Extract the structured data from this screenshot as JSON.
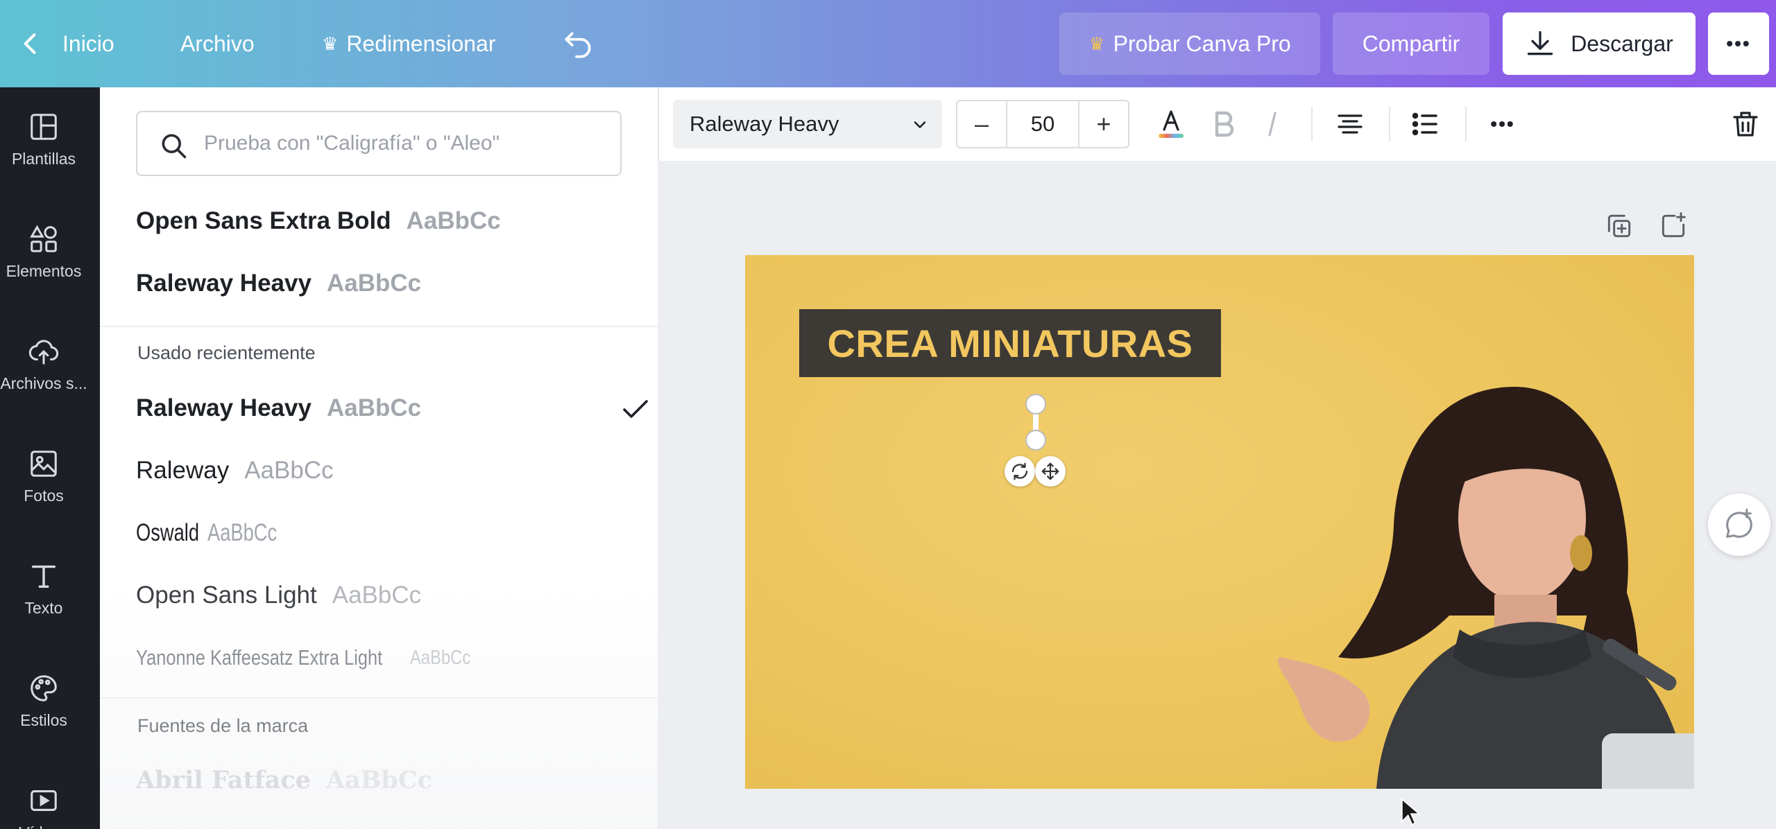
{
  "topbar": {
    "home_label": "Inicio",
    "file_label": "Archivo",
    "resize_label": "Redimensionar",
    "pro_label": "Probar Canva Pro",
    "share_label": "Compartir",
    "download_label": "Descargar",
    "more_label": "•••"
  },
  "rail": {
    "items": [
      {
        "label": "Plantillas",
        "icon": "layout-icon"
      },
      {
        "label": "Elementos",
        "icon": "shapes-icon"
      },
      {
        "label": "Archivos s...",
        "icon": "upload-cloud-icon"
      },
      {
        "label": "Fotos",
        "icon": "image-icon"
      },
      {
        "label": "Texto",
        "icon": "text-icon"
      },
      {
        "label": "Estilos",
        "icon": "palette-icon"
      },
      {
        "label": "Vídeos",
        "icon": "video-icon"
      }
    ]
  },
  "panel": {
    "search_placeholder": "Prueba con \"Caligrafía\" o \"Aleo\"",
    "sample_text": "AaBbCc",
    "top_fonts": [
      {
        "name": "Open Sans Extra Bold"
      },
      {
        "name": "Raleway Heavy"
      }
    ],
    "recent_title": "Usado recientemente",
    "recent_fonts": [
      {
        "name": "Raleway Heavy",
        "selected": true
      },
      {
        "name": "Raleway"
      },
      {
        "name": "Oswald"
      },
      {
        "name": "Open Sans Light"
      },
      {
        "name": "Yanonne Kaffeesatz Extra Light"
      }
    ],
    "brand_title": "Fuentes de la marca",
    "brand_fonts": [
      {
        "name": "Abril Fatface"
      }
    ]
  },
  "toolbar": {
    "font_family": "Raleway Heavy",
    "minus_label": "–",
    "font_size": "50",
    "plus_label": "+",
    "more_label": "•••"
  },
  "canvas": {
    "title_text": "CREA MINIATURAS"
  },
  "colors": {
    "design_background": "#ecc45c",
    "title_box": "#3d3a35",
    "title_text": "#f3c75f",
    "rail_background": "#1c1f26"
  }
}
